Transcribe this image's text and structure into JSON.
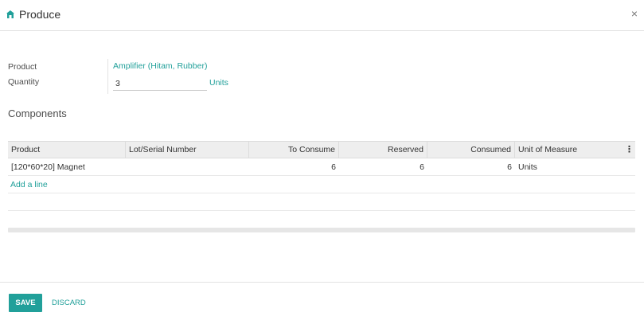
{
  "dialog": {
    "title": "Produce",
    "close_glyph": "×",
    "icon": "factory-icon"
  },
  "form": {
    "product_label": "Product",
    "product_value": "Amplifier (Hitam, Rubber)",
    "quantity_label": "Quantity",
    "quantity_value": "3",
    "quantity_uom": "Units"
  },
  "components": {
    "section_title": "Components",
    "columns": [
      "Product",
      "Lot/Serial Number",
      "To Consume",
      "Reserved",
      "Consumed",
      "Unit of Measure"
    ],
    "rows": [
      {
        "product": "[120*60*20] Magnet",
        "lot": "",
        "to_consume": "6",
        "reserved": "6",
        "consumed": "6",
        "uom": "Units"
      }
    ],
    "add_line_label": "Add a line"
  },
  "footer": {
    "save_label": "SAVE",
    "discard_label": "DISCARD"
  },
  "colors": {
    "accent": "#21a09a",
    "header_bg": "#eeeeee"
  }
}
